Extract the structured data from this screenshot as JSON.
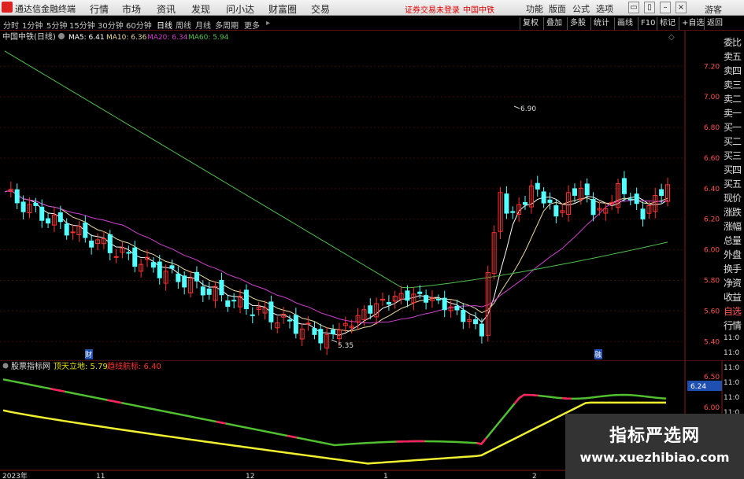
{
  "app": {
    "title": "通达信金融终端",
    "menus": [
      "行情",
      "市场",
      "资讯",
      "发现",
      "问小达",
      "财富圈",
      "交易"
    ],
    "notice": "证券交易未登录",
    "stock_link": "中国中铁",
    "top_buttons": [
      "功能",
      "版面",
      "公式",
      "选项"
    ],
    "guest": "游客"
  },
  "toolbar": {
    "periods": [
      "分时",
      "1分钟",
      "5分钟",
      "15分钟",
      "30分钟",
      "60分钟",
      "日线",
      "周线",
      "月线",
      "多周期",
      "更多"
    ],
    "active_period": "日线",
    "buttons": [
      "复权",
      "叠加",
      "多股",
      "统计",
      "画线",
      "F10",
      "标记",
      "+自选",
      "返回"
    ]
  },
  "sidepanel": {
    "items": [
      "委比",
      "卖五",
      "卖四",
      "卖三",
      "卖二",
      "卖一",
      "买一",
      "买二",
      "买三",
      "买四",
      "买五",
      "现价",
      "涨跌",
      "涨幅",
      "总量",
      "外盘",
      "换手",
      "净资",
      "收益",
      "自选",
      "行情"
    ]
  },
  "main_chart": {
    "stock_label": "中国中铁(日线)",
    "ma_legend": [
      {
        "label": "MA5: 6.41",
        "color": "#ffffff"
      },
      {
        "label": "MA10: 6.36",
        "color": "#e8d8a0"
      },
      {
        "label": "MA20: 6.34",
        "color": "#d040d0"
      },
      {
        "label": "MA60: 5.94",
        "color": "#50c050"
      }
    ],
    "y_ticks": [
      "7.20",
      "7.00",
      "6.80",
      "6.60",
      "6.40",
      "6.20",
      "6.00",
      "5.80",
      "5.60",
      "5.40"
    ],
    "ylim": [
      5.35,
      7.32
    ],
    "high_label": "6.90",
    "low_label": "5.35",
    "markers": [
      "财",
      "融"
    ],
    "up_color": "#ff3030",
    "down_color": "#54ffff"
  },
  "sub_chart": {
    "title": "股票指标网",
    "line1_label": "顶天立地: 5.79",
    "line2_label": "趋线航标: 6.40",
    "y_ticks": [
      "6.50",
      "6.00"
    ],
    "current_value": "6.24",
    "x_labels": [
      "2023年",
      "11",
      "12",
      "1",
      "2"
    ]
  },
  "time_column": [
    "11:0",
    "11:0",
    "11:0",
    "11:0",
    "11:0",
    "11:0",
    "11:0",
    "11:0"
  ],
  "watermark": {
    "title": "指标严选网",
    "url": "www.xuezhibiao.com"
  }
}
